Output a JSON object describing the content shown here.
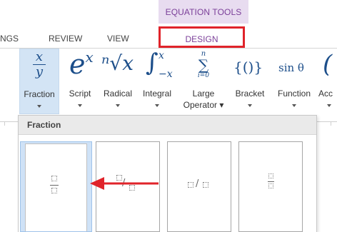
{
  "ribbon_header": {
    "context_group": "EQUATION TOOLS"
  },
  "tabs": [
    {
      "label": "NGS"
    },
    {
      "label": "REVIEW"
    },
    {
      "label": "VIEW"
    },
    {
      "label": "DESIGN",
      "selected": true
    }
  ],
  "ribbon": {
    "buttons": [
      {
        "label": "Fraction",
        "symbol_top": "x",
        "symbol_bottom": "y"
      },
      {
        "label": "Script",
        "symbol": "e",
        "sup": "x"
      },
      {
        "label": "Radical",
        "symbol": "ⁿ√x"
      },
      {
        "label": "Integral",
        "symbol": "∫",
        "sup": "x",
        "sub": "−x"
      },
      {
        "label": "Large",
        "label2": "Operator",
        "symbol": "∑",
        "sup": "n",
        "sub": "i=0"
      },
      {
        "label": "Bracket",
        "symbol": "{()}"
      },
      {
        "label": "Function",
        "symbol": "sin θ"
      },
      {
        "label": "Acc"
      }
    ]
  },
  "gallery": {
    "title": "Fraction",
    "items": [
      {
        "name": "Stacked Fraction"
      },
      {
        "name": "Skewed Fraction"
      },
      {
        "name": "Linear Fraction"
      },
      {
        "name": "Small Fraction"
      }
    ]
  },
  "colors": {
    "accent": "#7b3f99",
    "highlight": "#e0232a",
    "selected_bg": "#cfe2f7",
    "symbol": "#1c4e8a"
  }
}
